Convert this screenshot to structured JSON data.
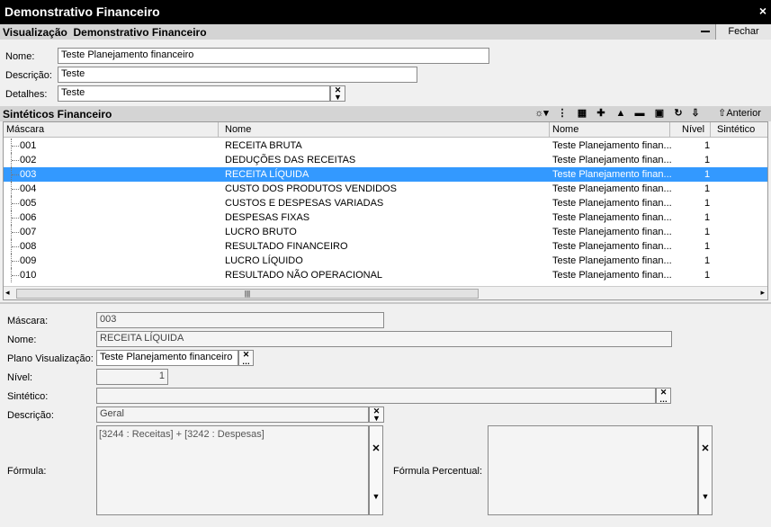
{
  "window": {
    "title": "Demonstrativo Financeiro",
    "close": "×"
  },
  "visualizacao": {
    "header_label": "Visualização",
    "header_name": "Demonstrativo Financeiro",
    "close_button": "Fechar"
  },
  "form": {
    "nome_label": "Nome:",
    "nome_value": "Teste Planejamento financeiro",
    "descricao_label": "Descrição:",
    "descricao_value": "Teste",
    "detalhes_label": "Detalhes:",
    "detalhes_value": "Teste"
  },
  "sinteticos": {
    "header": "Sintéticos Financeiro",
    "toolbar": {
      "anterior": "Anterior"
    },
    "columns": [
      "Máscara",
      "Nome",
      "Nome",
      "Nível",
      "Sintético"
    ],
    "rows": [
      {
        "mascara": "001",
        "nome": "RECEITA BRUTA",
        "plano": "Teste Planejamento finan...",
        "nivel": "1"
      },
      {
        "mascara": "002",
        "nome": "DEDUÇÕES DAS RECEITAS",
        "plano": "Teste Planejamento finan...",
        "nivel": "1"
      },
      {
        "mascara": "003",
        "nome": "RECEITA LÍQUIDA",
        "plano": "Teste Planejamento finan...",
        "nivel": "1"
      },
      {
        "mascara": "004",
        "nome": "CUSTO DOS PRODUTOS VENDIDOS",
        "plano": "Teste Planejamento finan...",
        "nivel": "1"
      },
      {
        "mascara": "005",
        "nome": "CUSTOS E DESPESAS VARIADAS",
        "plano": "Teste Planejamento finan...",
        "nivel": "1"
      },
      {
        "mascara": "006",
        "nome": "DESPESAS FIXAS",
        "plano": "Teste Planejamento finan...",
        "nivel": "1"
      },
      {
        "mascara": "007",
        "nome": "LUCRO BRUTO",
        "plano": "Teste Planejamento finan...",
        "nivel": "1"
      },
      {
        "mascara": "008",
        "nome": "RESULTADO FINANCEIRO",
        "plano": "Teste Planejamento finan...",
        "nivel": "1"
      },
      {
        "mascara": "009",
        "nome": "LUCRO LÍQUIDO",
        "plano": "Teste Planejamento finan...",
        "nivel": "1"
      },
      {
        "mascara": "010",
        "nome": "RESULTADO NÃO OPERACIONAL",
        "plano": "Teste Planejamento finan...",
        "nivel": "1"
      }
    ],
    "selected_index": 2
  },
  "detail": {
    "mascara_label": "Máscara:",
    "mascara_value": "003",
    "nome_label": "Nome:",
    "nome_value": "RECEITA LÍQUIDA",
    "plano_label": "Plano Visualização:",
    "plano_value": "Teste Planejamento financeiro",
    "nivel_label": "Nível:",
    "nivel_value": "1",
    "sintetico_label": "Sintético:",
    "sintetico_value": "",
    "descricao_label": "Descrição:",
    "descricao_value": "Geral",
    "formula_label": "Fórmula:",
    "formula_value": "[3244 : Receitas] + [3242 : Despesas]",
    "formula_percentual_label": "Fórmula Percentual:",
    "formula_percentual_value": ""
  },
  "colors": {
    "selection": "#3399ff",
    "titlebar": "#000000",
    "section": "#d4d4d4"
  }
}
